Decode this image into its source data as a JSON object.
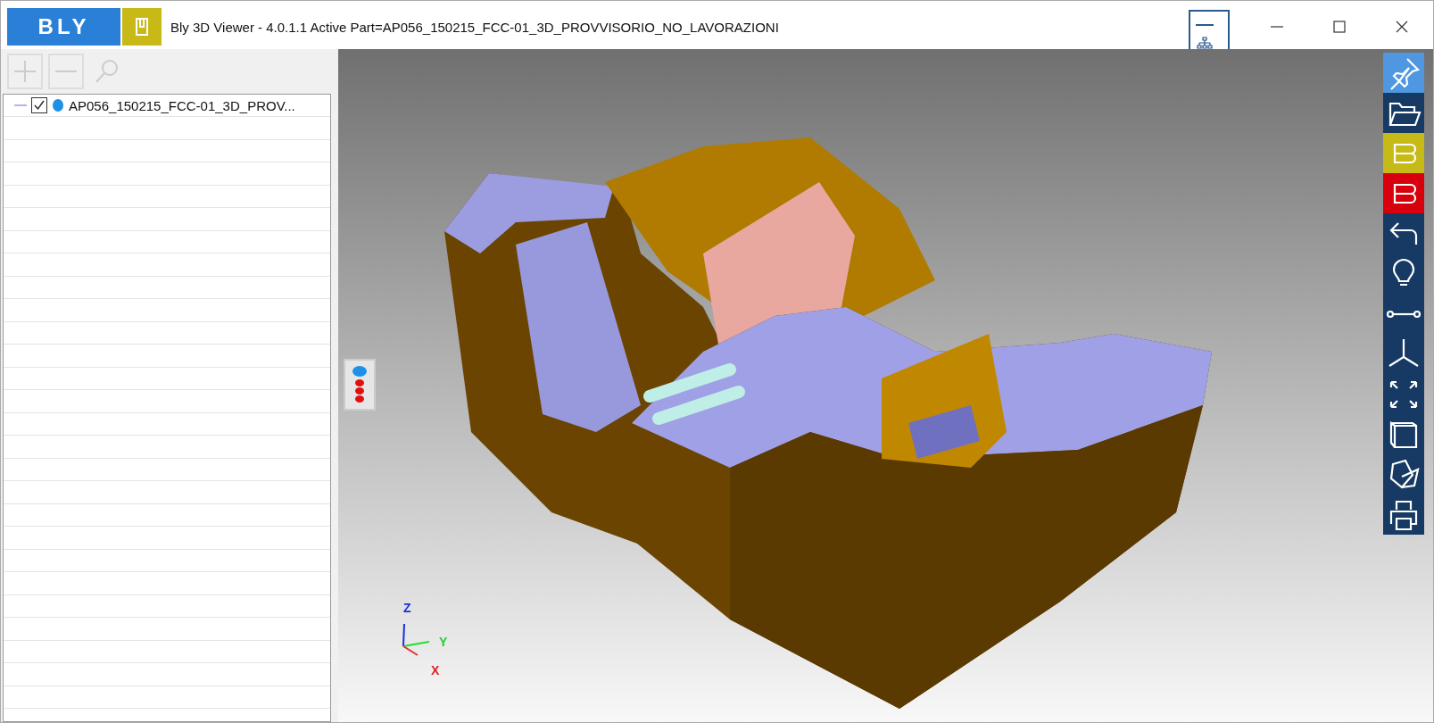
{
  "window": {
    "logo": "BLY",
    "title": "Bly 3D Viewer - 4.0.1.1 Active Part=AP056_150215_FCC-01_3D_PROVVISORIO_NO_LAVORAZIONI"
  },
  "tree_toolbar": [
    {
      "kind": "add",
      "disabled": true
    },
    {
      "kind": "remove",
      "disabled": true
    },
    {
      "kind": "search",
      "disabled": true
    }
  ],
  "tree": {
    "items": [
      {
        "label": "AP056_150215_FCC-01_3D_PROV...",
        "checked": true
      }
    ]
  },
  "viewport": {
    "axes": {
      "z": "Z",
      "y": "Y",
      "x": "X"
    }
  },
  "toolbar": [
    {
      "kind": "pin",
      "color": "#4f97e0"
    },
    {
      "kind": "folder",
      "color": "#163a63"
    },
    {
      "kind": "brand",
      "color": "#c6bb16"
    },
    {
      "kind": "brand",
      "color": "#d9000e"
    },
    {
      "kind": "undo",
      "color": "#163a63"
    },
    {
      "kind": "bulb",
      "color": "#163a63"
    },
    {
      "kind": "measure",
      "color": "#163a63"
    },
    {
      "kind": "axes",
      "color": "#163a63"
    },
    {
      "kind": "expand",
      "color": "#163a63"
    },
    {
      "kind": "cube",
      "color": "#163a63"
    },
    {
      "kind": "section",
      "color": "#163a63"
    },
    {
      "kind": "print",
      "color": "#163a63"
    }
  ]
}
